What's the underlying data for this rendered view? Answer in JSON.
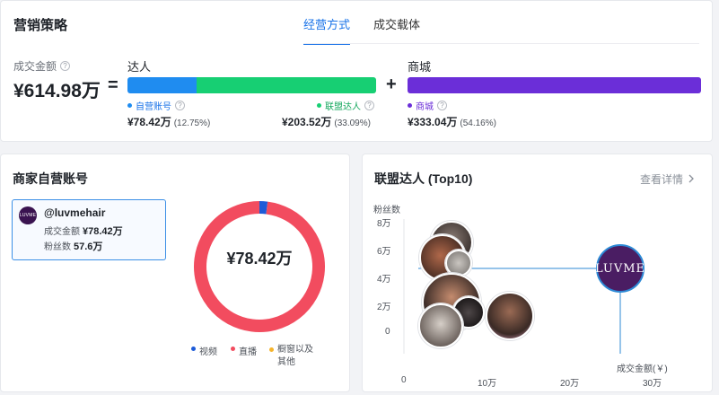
{
  "top": {
    "title": "营销策略",
    "tabs": [
      "经营方式",
      "成交载体"
    ],
    "gmv_label": "成交金额",
    "gmv_value": "¥614.98万",
    "equals": "=",
    "plus": "+",
    "creator_group": {
      "label": "达人",
      "self_label": "自营账号",
      "self_amount": "¥78.42万",
      "self_pct": "(12.75%)",
      "alliance_label": "联盟达人",
      "alliance_amount": "¥203.52万",
      "alliance_pct": "(33.09%)",
      "self_share": 12.75,
      "alliance_share": 33.09
    },
    "mall_group": {
      "label": "商城",
      "item_label": "商城",
      "amount": "¥333.04万",
      "pct": "(54.16%)",
      "share": 54.16
    },
    "help_glyph": "?"
  },
  "self_accounts": {
    "title": "商家自营账号",
    "account": {
      "name": "@luvmehair",
      "avatar_text": "LUVME",
      "gmv_label": "成交金额",
      "gmv_value": "¥78.42万",
      "fans_label": "粉丝数",
      "fans_value": "57.6万"
    },
    "donut_center": "¥78.42万",
    "donut_shares": {
      "video": 0.02,
      "live": 0.98,
      "window": 0.0
    },
    "legend": [
      "视频",
      "直播",
      "橱窗以及其他"
    ]
  },
  "alliance": {
    "title": "联盟达人 (Top10)",
    "more_label": "查看详情",
    "y_axis_title": "粉丝数",
    "y_ticks": [
      "8万",
      "6万",
      "4万",
      "2万",
      "0"
    ],
    "x_ticks": [
      "0",
      "10万",
      "20万",
      "30万"
    ],
    "x_axis_title": "成交金额(￥)",
    "highlight_label": "LUVME"
  },
  "colors": {
    "self": "#1f8cf0",
    "alliance": "#17cf73",
    "mall": "#6b2ed8",
    "video": "#1d5bd8",
    "live": "#f24c5f",
    "window": "#f6b42b",
    "accent": "#1a73e8"
  }
}
